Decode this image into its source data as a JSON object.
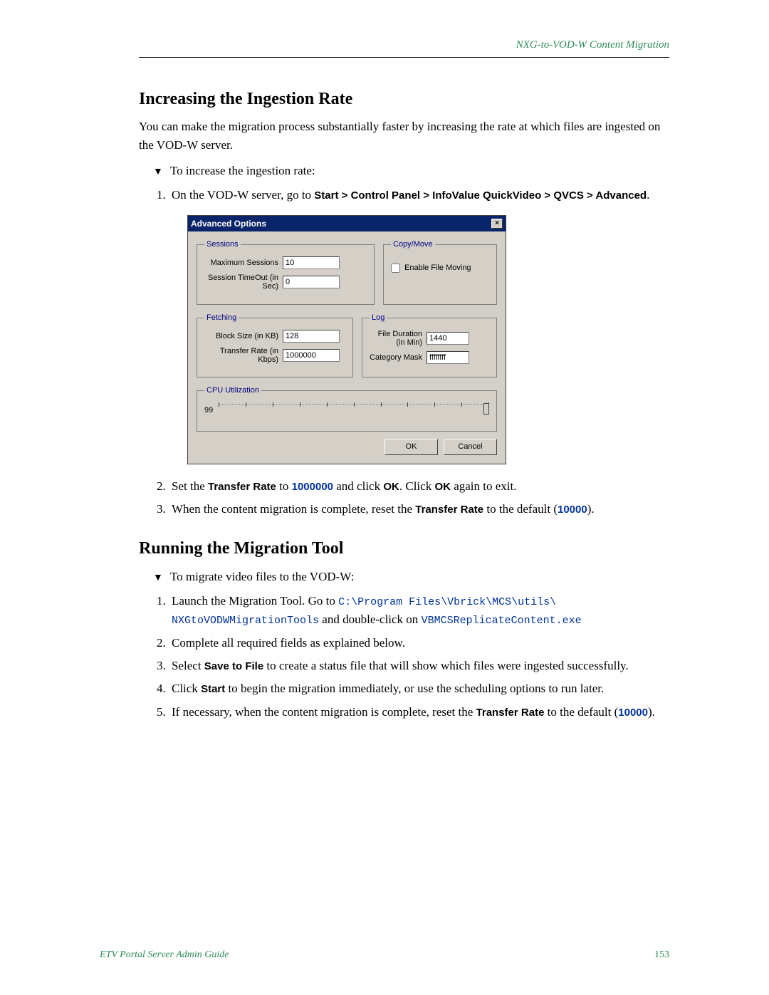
{
  "header": {
    "section_title": "NXG-to-VOD-W Content Migration"
  },
  "h_ingestion": "Increasing the Ingestion Rate",
  "p_ingestion": "You can make the migration process substantially faster by increasing the rate at which files are ingested on the VOD-W server.",
  "proc1_intro": "To increase the ingestion rate:",
  "proc1_step1_a": "On the VOD-W server, go to ",
  "proc1_step1_b": "Start > Control Panel > InfoValue QuickVideo > QVCS > Advanced",
  "proc1_step1_c": ".",
  "dialog": {
    "title": "Advanced Options",
    "sessions": {
      "legend": "Sessions",
      "max_label": "Maximum Sessions",
      "max_value": "10",
      "timeout_label": "Session TimeOut (in Sec)",
      "timeout_value": "0"
    },
    "copymove": {
      "legend": "Copy/Move",
      "enable_label": "Enable File Moving"
    },
    "fetching": {
      "legend": "Fetching",
      "block_label": "Block Size (in KB)",
      "block_value": "128",
      "rate_label": "Transfer Rate (in Kbps)",
      "rate_value": "1000000"
    },
    "log": {
      "legend": "Log",
      "dur_label": "File Duration (in Min)",
      "dur_value": "1440",
      "cat_label": "Category Mask",
      "cat_value": "ffffffff"
    },
    "cpu": {
      "legend": "CPU Utilization",
      "value": "99"
    },
    "ok": "OK",
    "cancel": "Cancel"
  },
  "proc1_step2_a": "Set the ",
  "proc1_step2_b": "Transfer Rate",
  "proc1_step2_c": " to ",
  "proc1_step2_d": "1000000",
  "proc1_step2_e": " and click ",
  "proc1_step2_f": "OK",
  "proc1_step2_g": ". Click ",
  "proc1_step2_h": "OK",
  "proc1_step2_i": " again to exit.",
  "proc1_step3_a": "When the content migration is complete, reset the ",
  "proc1_step3_b": "Transfer Rate",
  "proc1_step3_c": " to the default (",
  "proc1_step3_d": "10000",
  "proc1_step3_e": ").",
  "h_running": "Running the Migration Tool",
  "proc2_intro": "To migrate video files to the VOD-W:",
  "proc2_step1_a": "Launch the Migration Tool. Go to ",
  "proc2_step1_b": "C:\\Program Files\\Vbrick\\MCS\\utils\\ NXGtoVODWMigrationTools",
  "proc2_step1_c": " and double-click on ",
  "proc2_step1_d": "VBMCSReplicateContent.exe",
  "proc2_step2": "Complete all required fields as explained below.",
  "proc2_step3_a": "Select ",
  "proc2_step3_b": "Save to File",
  "proc2_step3_c": " to create a status file that will show which files were ingested successfully.",
  "proc2_step4_a": "Click ",
  "proc2_step4_b": "Start",
  "proc2_step4_c": " to begin the migration immediately, or use the scheduling options to run later.",
  "proc2_step5_a": "If necessary, when the content migration is complete, reset the ",
  "proc2_step5_b": "Transfer Rate",
  "proc2_step5_c": " to the default (",
  "proc2_step5_d": "10000",
  "proc2_step5_e": ").",
  "footer": {
    "left": "ETV Portal Server Admin Guide",
    "right": "153"
  }
}
